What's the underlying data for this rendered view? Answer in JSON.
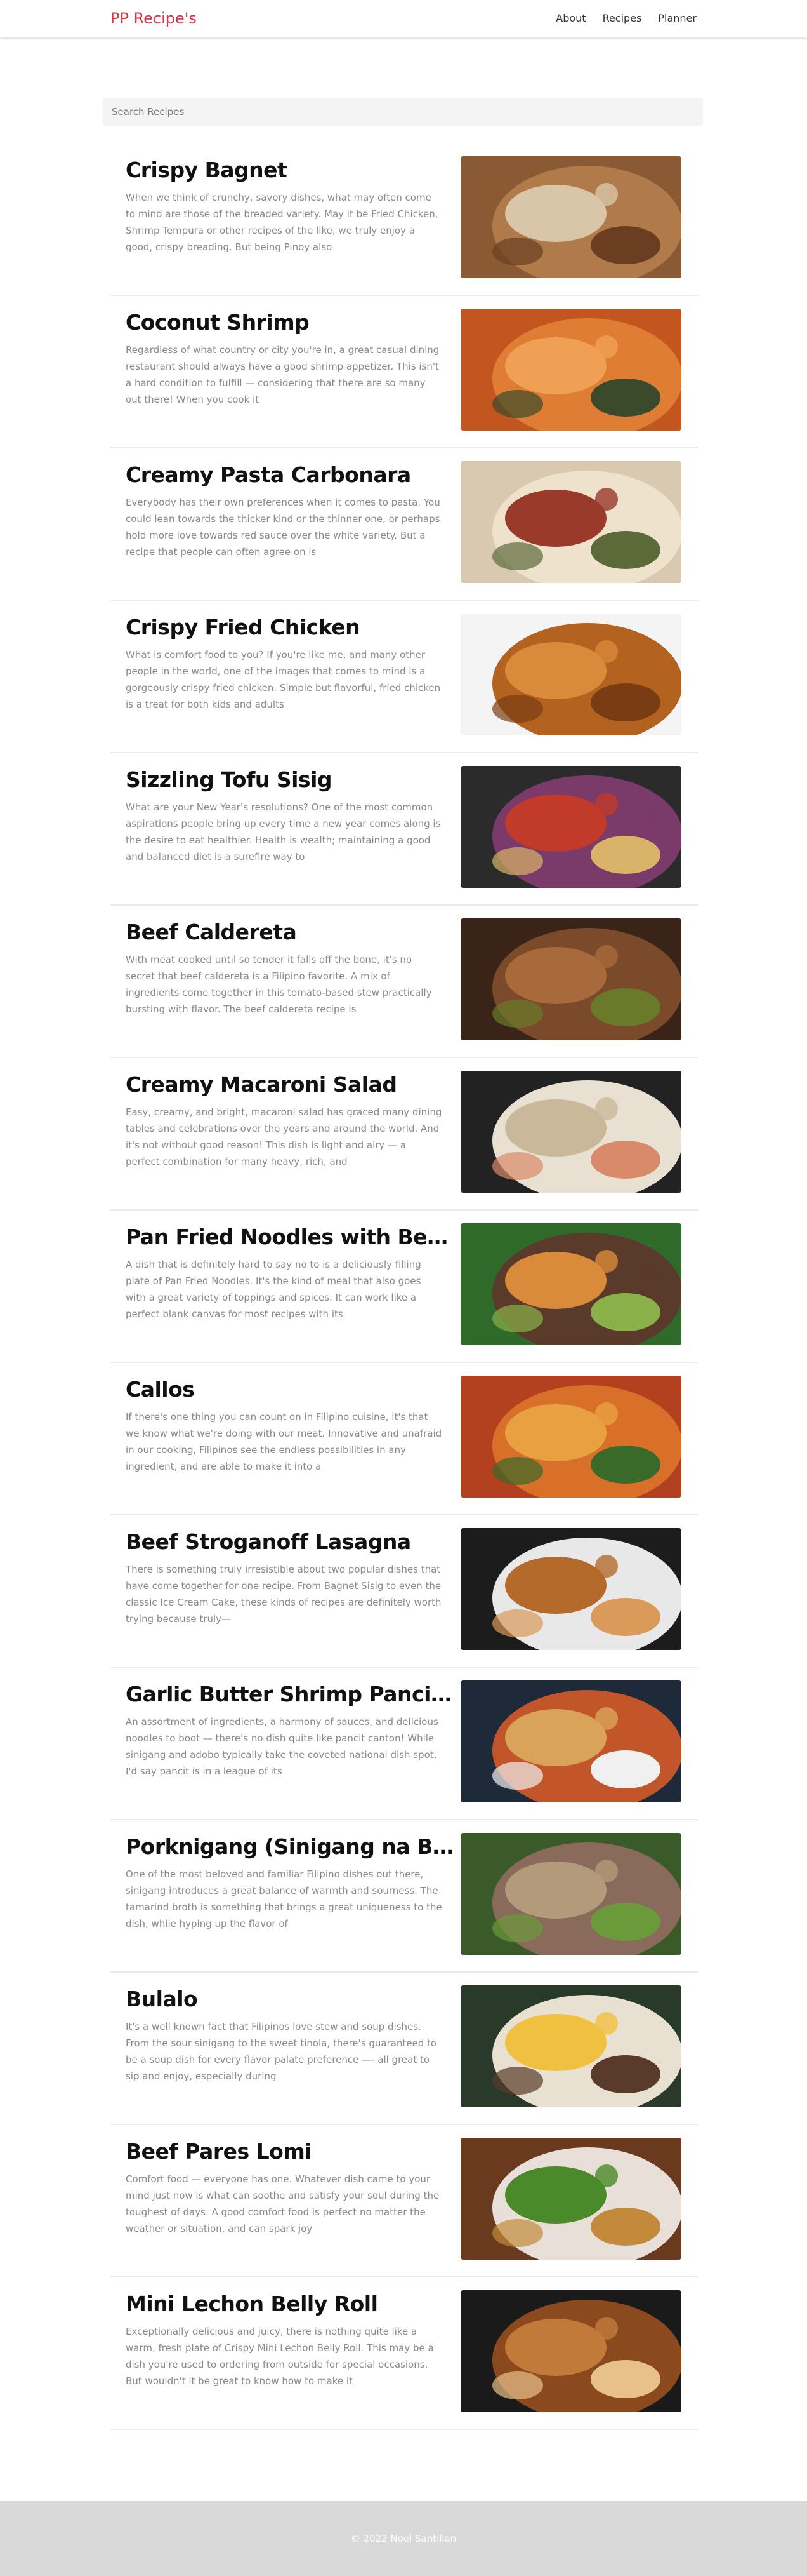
{
  "nav": {
    "brand": "PP Recipe's",
    "links": [
      "About",
      "Recipes",
      "Planner"
    ]
  },
  "search": {
    "placeholder": "Search Recipes"
  },
  "recipes": [
    {
      "title": "Crispy Bagnet",
      "excerpt": "When we think of crunchy, savory dishes, what may often come to mind are those of the breaded variety. May it be Fried Chicken, Shrimp Tempura or other recipes of the like, we truly enjoy a good, crispy breading. But being Pinoy also",
      "image": "crispy-bagnet-photo",
      "colors": [
        "#8a5a35",
        "#b07a4a",
        "#d9c5a8",
        "#6b3e22"
      ]
    },
    {
      "title": "Coconut Shrimp",
      "excerpt": "Regardless of what country or city you're in, a great casual dining restaurant should always have a good shrimp appetizer. This isn't a hard condition to fulfill — considering that there are so many out there! When you cook it",
      "image": "coconut-shrimp-photo",
      "colors": [
        "#c2561e",
        "#e07d35",
        "#f0a055",
        "#3a4a2a"
      ]
    },
    {
      "title": "Creamy Pasta Carbonara",
      "excerpt": "Everybody has their own preferences when it comes to pasta. You could lean towards the thicker kind or the thinner one, or perhaps hold more love towards red sauce over the white variety. But a recipe that people can often agree on is",
      "image": "pasta-carbonara-photo",
      "colors": [
        "#d9c9b0",
        "#eee2cc",
        "#9a3a2a",
        "#5c6a3a"
      ]
    },
    {
      "title": "Crispy Fried Chicken",
      "excerpt": "What is comfort food to you? If you're like me, and many other people in the world, one of the images that comes to mind is a gorgeously crispy fried chicken. Simple but flavorful, fried chicken is a treat for both kids and adults",
      "image": "fried-chicken-photo",
      "colors": [
        "#f4f4f4",
        "#b3621f",
        "#d98a3a",
        "#7a3c12"
      ]
    },
    {
      "title": "Sizzling Tofu Sisig",
      "excerpt": "What are your New Year's resolutions? One of the most common aspirations people bring up every time a new year comes along is the desire to eat healthier. Health is wealth; maintaining a good and balanced diet is a surefire way to",
      "image": "tofu-sisig-photo",
      "colors": [
        "#2b2b2b",
        "#7a3a6a",
        "#c23a2a",
        "#d9b36a"
      ]
    },
    {
      "title": "Beef Caldereta",
      "excerpt": "With meat cooked until so tender it falls off the bone, it's no secret that beef caldereta is a Filipino favorite. A mix of ingredients come together in this tomato-based stew practically bursting with flavor. The beef caldereta recipe is",
      "image": "beef-caldereta-photo",
      "colors": [
        "#3a2418",
        "#7a4a2a",
        "#a86a3a",
        "#6a7a2a"
      ]
    },
    {
      "title": "Creamy Macaroni Salad",
      "excerpt": "Easy, creamy, and bright, macaroni salad has graced many dining tables and celebrations over the years and around the world. And it's not without good reason! This dish is light and airy — a perfect combination for many heavy, rich, and",
      "image": "macaroni-salad-photo",
      "colors": [
        "#222222",
        "#e8e0d0",
        "#c9b89a",
        "#d98a6a"
      ]
    },
    {
      "title": "Pan Fried Noodles with Beef and Bok Choy",
      "excerpt": "A dish that is definitely hard to say no to is a deliciously filling plate of Pan Fried Noodles. It's the kind of meal that also goes with a great variety of toppings and spices. It can work like a perfect blank canvas for most recipes with its",
      "image": "pan-fried-noodles-photo",
      "colors": [
        "#2f6a2a",
        "#5a3a2a",
        "#d98a3a",
        "#8ab04a"
      ]
    },
    {
      "title": "Callos",
      "excerpt": "If there's one thing you can count on in Filipino cuisine, it's that we know what we're doing with our meat. Innovative and unafraid in our cooking, Filipinos see the endless possibilities in any ingredient, and are able to make it into a",
      "image": "callos-photo",
      "colors": [
        "#b3401f",
        "#d9702a",
        "#e8a040",
        "#3a6a2a"
      ]
    },
    {
      "title": "Beef Stroganoff Lasagna",
      "excerpt": "There is something truly irresistible about two popular dishes that have come together for one recipe. From Bagnet Sisig to even the classic Ice Cream Cake, these kinds of recipes are definitely worth trying because truly—",
      "image": "beef-stroganoff-lasagna-photo",
      "colors": [
        "#1c1c1c",
        "#e8e8e8",
        "#b36a2a",
        "#d99a5a"
      ]
    },
    {
      "title": "Garlic Butter Shrimp Pancit Canton",
      "excerpt": "An assortment of ingredients, a harmony of sauces, and delicious noodles to boot — there's no dish quite like pancit canton! While sinigang and adobo typically take the coveted national dish spot, I'd say pancit is in a league of its",
      "image": "shrimp-pancit-canton-photo",
      "colors": [
        "#1e2a3a",
        "#c2562a",
        "#d9a45a",
        "#f0f0f0"
      ]
    },
    {
      "title": "Porknigang (Sinigang na Baboy)",
      "excerpt": "One of the most beloved and familiar Filipino dishes out there, sinigang introduces a great balance of warmth and sourness. The tamarind broth is something that brings a great uniqueness to the dish, while hyping up the flavor of",
      "image": "porknigang-photo",
      "colors": [
        "#3a5a2a",
        "#8a6a5a",
        "#b39a7a",
        "#6a9a3a"
      ]
    },
    {
      "title": "Bulalo",
      "excerpt": "It's a well known fact that Filipinos love stew and soup dishes. From the sour sinigang to the sweet tinola, there's guaranteed to be a soup dish for every flavor palate preference —- all great to sip and enjoy, especially during",
      "image": "bulalo-photo",
      "colors": [
        "#2a3a2a",
        "#e8e0d0",
        "#f0c040",
        "#5a3a2a"
      ]
    },
    {
      "title": "Beef Pares Lomi",
      "excerpt": "Comfort food — everyone has one. Whatever dish came to your mind just now is what can soothe and satisfy your soul during the toughest of days. A good comfort food is perfect no matter the weather or situation, and can spark joy",
      "image": "beef-pares-lomi-photo",
      "colors": [
        "#6a3a1e",
        "#e8e0d8",
        "#4a8a2a",
        "#c28a3a"
      ]
    },
    {
      "title": "Mini Lechon Belly Roll",
      "excerpt": "Exceptionally delicious and juicy, there is nothing quite like a warm, fresh plate of Crispy Mini Lechon Belly Roll. This may be a dish you're used to ordering from outside for special occasions. But wouldn't it be great to know how to make it",
      "image": "lechon-belly-roll-photo",
      "colors": [
        "#1a1a1a",
        "#8a4a1e",
        "#c27a3a",
        "#e8c08a"
      ]
    }
  ],
  "footer": {
    "text": "© 2022 Noel Santillan"
  },
  "theme": {
    "brand_color": "#dc3545",
    "footer_bg": "#d9d9d9",
    "excerpt_color": "#8a8a8a"
  }
}
